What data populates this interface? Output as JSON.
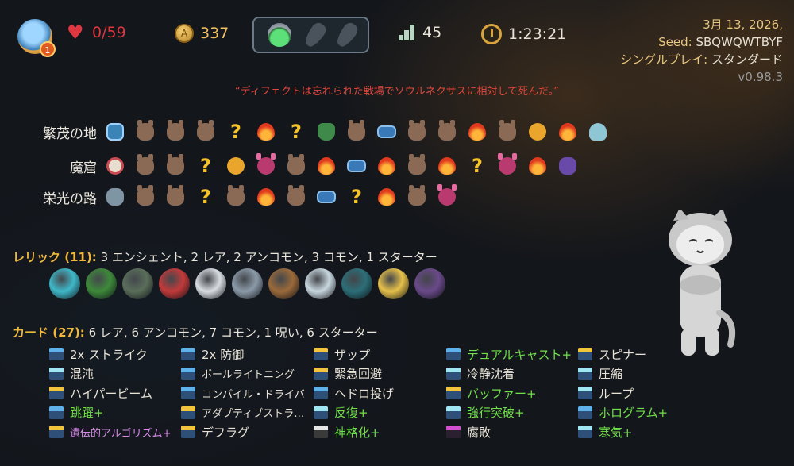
{
  "top_bar": {
    "character": {
      "icon": "character-portrait-icon",
      "ascension": "1"
    },
    "hp": {
      "icon": "heart-icon",
      "value": "0/59",
      "color": "#e0363f"
    },
    "gold": {
      "icon": "gold-coin-icon",
      "value": "337"
    },
    "potions": [
      {
        "icon": "green-potion-icon",
        "state": "full"
      },
      {
        "icon": "empty-potion-slot-icon",
        "state": "empty"
      },
      {
        "icon": "empty-potion-slot-icon",
        "state": "empty"
      }
    ],
    "floor": {
      "icon": "stairs-icon",
      "value": "45"
    },
    "time": {
      "icon": "stopwatch-icon",
      "value": "1:23:21"
    }
  },
  "run_info": {
    "date": "3月 13, 2026,",
    "seed_label": "Seed:",
    "seed": "SBQWQWTBYF",
    "mode_label": "シングルプレイ:",
    "mode": "スタンダード",
    "version": "v0.98.3"
  },
  "death_message": "“ディフェクトは忘れられた戦場でソウルネクサスに相対して死んだ。”",
  "map_history": [
    {
      "act": "繁茂の地",
      "nodes": [
        "boss",
        "monster",
        "monster",
        "monster",
        "unknown",
        "rest",
        "unknown",
        "shop",
        "monster",
        "treasure",
        "monster",
        "monster",
        "rest",
        "monster",
        "event",
        "rest",
        "finalboss"
      ]
    },
    {
      "act": "魔窟",
      "nodes": [
        "boss2",
        "monster",
        "monster",
        "unknown",
        "event",
        "elite",
        "monster",
        "rest",
        "treasure",
        "rest",
        "monster",
        "rest",
        "unknown",
        "elite",
        "rest",
        "enemyboss"
      ]
    },
    {
      "act": "栄光の路",
      "nodes": [
        "boss3",
        "monster",
        "monster",
        "unknown",
        "monster",
        "rest",
        "monster",
        "treasure",
        "unknown",
        "rest",
        "monster",
        "elite"
      ]
    }
  ],
  "relics": {
    "label": "レリック (11):",
    "summary": "3 エンシェント, 2 レア, 2 アンコモン, 3 コモン, 1 スターター",
    "items": [
      {
        "icon": "cyan-orb-relic-icon",
        "color": "#3fb8c8"
      },
      {
        "icon": "leaf-bundle-relic-icon",
        "color": "#3e8a3a"
      },
      {
        "icon": "teapot-relic-icon",
        "color": "#5a6e5a"
      },
      {
        "icon": "lipstick-relic-icon",
        "color": "#c23a3a"
      },
      {
        "icon": "white-egg-relic-icon",
        "color": "#d8dde2"
      },
      {
        "icon": "spinning-top-relic-icon",
        "color": "#8b9aa8"
      },
      {
        "icon": "wooden-post-relic-icon",
        "color": "#9b6a3a"
      },
      {
        "icon": "pocket-watch-relic-icon",
        "color": "#c8d6de"
      },
      {
        "icon": "treasure-chest-relic-icon",
        "color": "#2c6e78"
      },
      {
        "icon": "golden-horn-relic-icon",
        "color": "#e6c04a"
      },
      {
        "icon": "purple-jewel-relic-icon",
        "color": "#6a4a8a"
      }
    ]
  },
  "cards": {
    "label": "カード (27):",
    "summary": "6 レア, 6 アンコモン, 7 コモン, 1 呪い, 6 スターター",
    "columns": [
      [
        {
          "name": "2x ストライク",
          "type": "attack",
          "upgraded": false
        },
        {
          "name": "混沌",
          "type": "power",
          "upgraded": false
        },
        {
          "name": "ハイパービーム",
          "type": "skill",
          "upgraded": false
        },
        {
          "name": "跳躍+",
          "type": "attack",
          "upgraded": true
        },
        {
          "name": "遺伝的アルゴリズム+",
          "type": "skill",
          "upgraded": true
        }
      ],
      [
        {
          "name": "2x 防御",
          "type": "attack",
          "upgraded": false
        },
        {
          "name": "ボールライトニング",
          "type": "attack",
          "upgraded": false
        },
        {
          "name": "コンパイル・ドライバ",
          "type": "attack",
          "upgraded": false
        },
        {
          "name": "アダプティブストラ…",
          "type": "skill",
          "upgraded": false
        },
        {
          "name": "デフラグ",
          "type": "skill",
          "upgraded": false
        }
      ],
      [
        {
          "name": "ザップ",
          "type": "skill",
          "upgraded": false
        },
        {
          "name": "緊急回避",
          "type": "skill",
          "upgraded": false
        },
        {
          "name": "ヘドロ投げ",
          "type": "attack",
          "upgraded": false
        },
        {
          "name": "反復+",
          "type": "power",
          "upgraded": true
        },
        {
          "name": "神格化+",
          "type": "status",
          "upgraded": true
        }
      ],
      [
        {
          "name": "デュアルキャスト+",
          "type": "attack",
          "upgraded": true
        },
        {
          "name": "冷静沈着",
          "type": "power",
          "upgraded": false
        },
        {
          "name": "バッファー+",
          "type": "skill",
          "upgraded": true
        },
        {
          "name": "強行突破+",
          "type": "power",
          "upgraded": true
        },
        {
          "name": "腐敗",
          "type": "curse",
          "upgraded": false
        }
      ],
      [
        {
          "name": "スピナー",
          "type": "skill",
          "upgraded": false
        },
        {
          "name": "圧縮",
          "type": "power",
          "upgraded": false
        },
        {
          "name": "ループ",
          "type": "power",
          "upgraded": false
        },
        {
          "name": "ホログラム+",
          "type": "attack",
          "upgraded": true
        },
        {
          "name": "寒気+",
          "type": "power",
          "upgraded": true
        }
      ]
    ]
  },
  "mascot": {
    "icon": "cat-mascot-icon"
  }
}
